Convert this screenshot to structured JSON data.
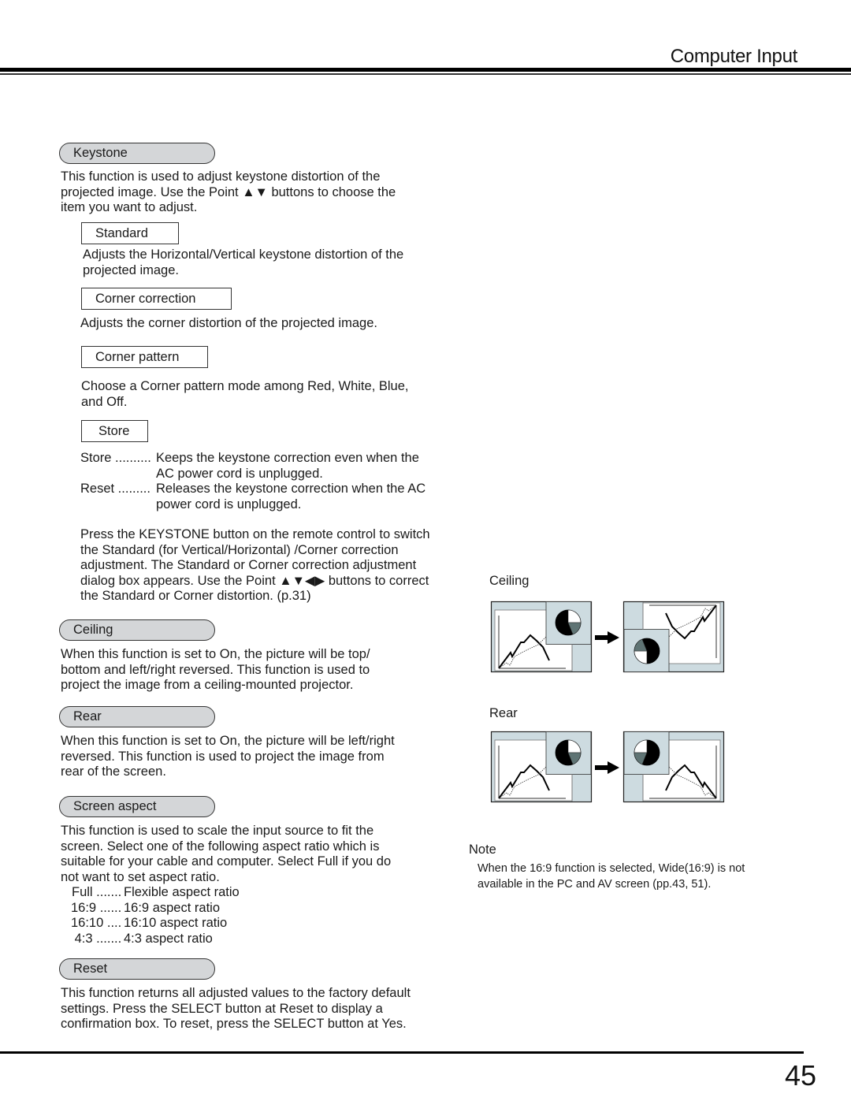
{
  "header": {
    "title": "Computer Input"
  },
  "footer": {
    "page_number": "45"
  },
  "keystone": {
    "heading": "Keystone",
    "intro": "This function is used to adjust keystone distortion of the\nprojected image. Use the Point ▲▼ buttons to choose the\nitem you want to adjust.",
    "standard": {
      "label": "Standard",
      "desc": "Adjusts the Horizontal/Vertical keystone distortion of the\nprojected image."
    },
    "corner_correction": {
      "label": "Corner correction",
      "desc": "Adjusts the corner distortion of the projected image."
    },
    "corner_pattern": {
      "label": "Corner pattern",
      "desc": "Choose a Corner pattern mode among Red, White, Blue,\nand Off."
    },
    "store": {
      "label": "Store",
      "options": [
        {
          "key": "Store ..........",
          "value": "Keeps the keystone correction even when the\nAC power cord is unplugged."
        },
        {
          "key": "Reset .........",
          "value": "Releases the keystone correction when the AC\npower cord is unplugged."
        }
      ]
    },
    "remote_note": "Press the KEYSTONE button on the remote control to switch\nthe Standard (for Vertical/Horizontal) /Corner correction\nadjustment. The Standard or Corner correction adjustment\ndialog box appears. Use the Point ▲▼◀▶ buttons to correct\nthe Standard or Corner distortion.  (p.31)"
  },
  "ceiling": {
    "heading": "Ceiling",
    "desc": "When this function is set to On, the picture will be top/\nbottom and left/right reversed. This function is used to\nproject the image from a ceiling-mounted projector.",
    "figure_label": "Ceiling"
  },
  "rear": {
    "heading": "Rear",
    "desc": "When this function is set to On, the picture will be left/right\nreversed. This function is used to project the image from\nrear of the screen.",
    "figure_label": "Rear"
  },
  "screen_aspect": {
    "heading": "Screen aspect",
    "desc": "This function is used to scale the input source to fit the\nscreen. Select one of the following aspect ratio which is\nsuitable for your cable and computer. Select  Full  if you do\nnot want to set aspect ratio.",
    "options": [
      {
        "key": "Full .......",
        "value": "Flexible aspect ratio"
      },
      {
        "key": "16:9 ......",
        "value": "16:9 aspect ratio"
      },
      {
        "key": "16:10 ....",
        "value": "16:10 aspect ratio"
      },
      {
        "key": " 4:3 .......",
        "value": "4:3 aspect ratio"
      }
    ]
  },
  "reset": {
    "heading": "Reset",
    "desc": "This function returns all adjusted values to the factory default\nsettings. Press the SELECT button at Reset to display a\nconfirmation box. To reset, press the SELECT button at Yes."
  },
  "note": {
    "heading": "Note",
    "text": "When the 16:9 function is selected, Wide(16:9) is not\navailable in the PC and AV screen (pp.43, 51)."
  },
  "colors": {
    "panel_fill": "#cddbe0",
    "pill_fill": "#d4d6d8",
    "pie_gray": "#5f7474"
  }
}
